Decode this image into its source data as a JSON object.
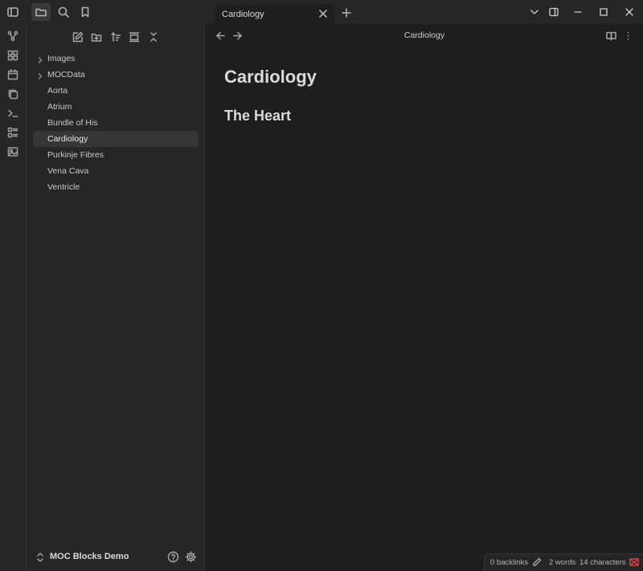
{
  "titlebar": {
    "tab_title": "Cardiology"
  },
  "sidebar": {
    "tree": [
      {
        "label": "Images",
        "folder": true
      },
      {
        "label": "MOCData",
        "folder": true
      },
      {
        "label": "Aorta",
        "folder": false
      },
      {
        "label": "Atrium",
        "folder": false
      },
      {
        "label": "Bundle of His",
        "folder": false
      },
      {
        "label": "Cardiology",
        "folder": false,
        "active": true
      },
      {
        "label": "Purkinje Fibres",
        "folder": false
      },
      {
        "label": "Vena Cava",
        "folder": false
      },
      {
        "label": "Ventricle",
        "folder": false
      }
    ],
    "vault_name": "MOC Blocks Demo"
  },
  "main": {
    "header_title": "Cardiology",
    "inline_title": "Cardiology",
    "heading1": "The Heart"
  },
  "statusbar": {
    "backlinks": "0 backlinks",
    "words": "2 words",
    "characters": "14 characters"
  },
  "colors": {
    "background": "#1e1e1e",
    "panel": "#262626",
    "active_item": "#363636",
    "sync_icon": "#e0414a"
  }
}
